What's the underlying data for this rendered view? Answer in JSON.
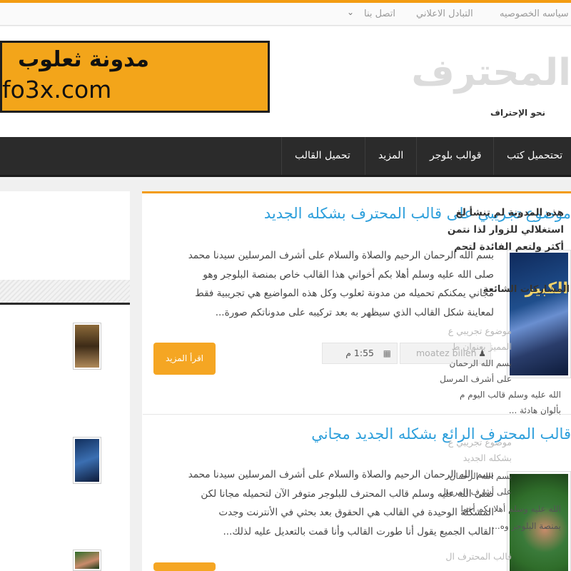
{
  "topnav": {
    "links": [
      "سياسه الخصوصيه",
      "التبادل الاعلاني",
      "اتصل بنا"
    ]
  },
  "header": {
    "banner_line1": "مدونة ثعلوب",
    "banner_line2": "fo3x.com",
    "logo_text": "المحترف",
    "tagline": "نحو الإحتراف"
  },
  "mainnav": {
    "items": [
      "تحتحميل كتب",
      "قوالب بلوجر",
      "المزيد",
      "تحميل القالب"
    ]
  },
  "posts": [
    {
      "title": "موضوع تجريبي على قالب المحترف بشكله الجديد",
      "excerpt": [
        "بسم الله الرحمان الرحيم والصلاة والسلام على أشرف المرسلين سيدنا محمد",
        "صلى الله عليه وسلم  أهلا بكم أخواني هذا القالب خاص بمنصة البلوجر وهو",
        "مجاني يمكنكم تحميله من مدونة ثعلوب وكل هذه المواضيع هي تجريبية فقط",
        "لمعاينة شكل القالب الذي سيظهر به بعد تركيبه على مدوناتكم  صورة..."
      ],
      "author": "moatez billeh",
      "time": "1:55 م",
      "read_more": "اقرأ المزيد",
      "thumb_text": "الكبير"
    },
    {
      "title": "قالب المحترف الرائع بشكله الجديد مجاني",
      "excerpt": [
        "بسم الله الرحمان الرحيم والصلاة والسلام على أشرف المرسلين سيدنا محمد",
        "صلى الله عليه وسلم  قالب المحترف للبلوجر متوفر الآن لتحميله مجانا لكن",
        "المشكلة الوحيدة في القالب هي الحقوق بعد بحثي في الأنترنت وجدت",
        "القالب الجميع يقول أنا طورت القالب وأنا قمت بالتعديل عليه لذلك..."
      ]
    }
  ],
  "sidebar": {
    "intro": [
      "هذه المدونة لم تنشأ لغ",
      "استغلالي للزوار لذا نتمن",
      "أكثر ولتعم الفائدة لتحم"
    ],
    "popular_title": "المشاركات الشائعة",
    "popular": [
      {
        "title": [
          "موضوع تجريبي ع",
          "المميز بعنوان ط"
        ],
        "text": [
          "بسم الله الرحمان",
          "على أشرف المرسل",
          "الله عليه وسلم  قالب اليوم م",
          "بألوان هادئة ..."
        ]
      },
      {
        "title": [
          "موضوع تجريبي ع",
          "بشكله الجديد"
        ],
        "text": [
          "بسم الله الرحمان",
          "على أشرف المرسل",
          "الله عليه وسلم  أهلا بكم أخوا",
          "بمنصة البلوجر وه..."
        ]
      },
      {
        "title": [
          "قالب المحترف ال"
        ],
        "text": []
      }
    ]
  },
  "colors": {
    "accent": "#f39c12",
    "link": "#2e9fdb",
    "nav_bg": "#2b2b2b"
  }
}
